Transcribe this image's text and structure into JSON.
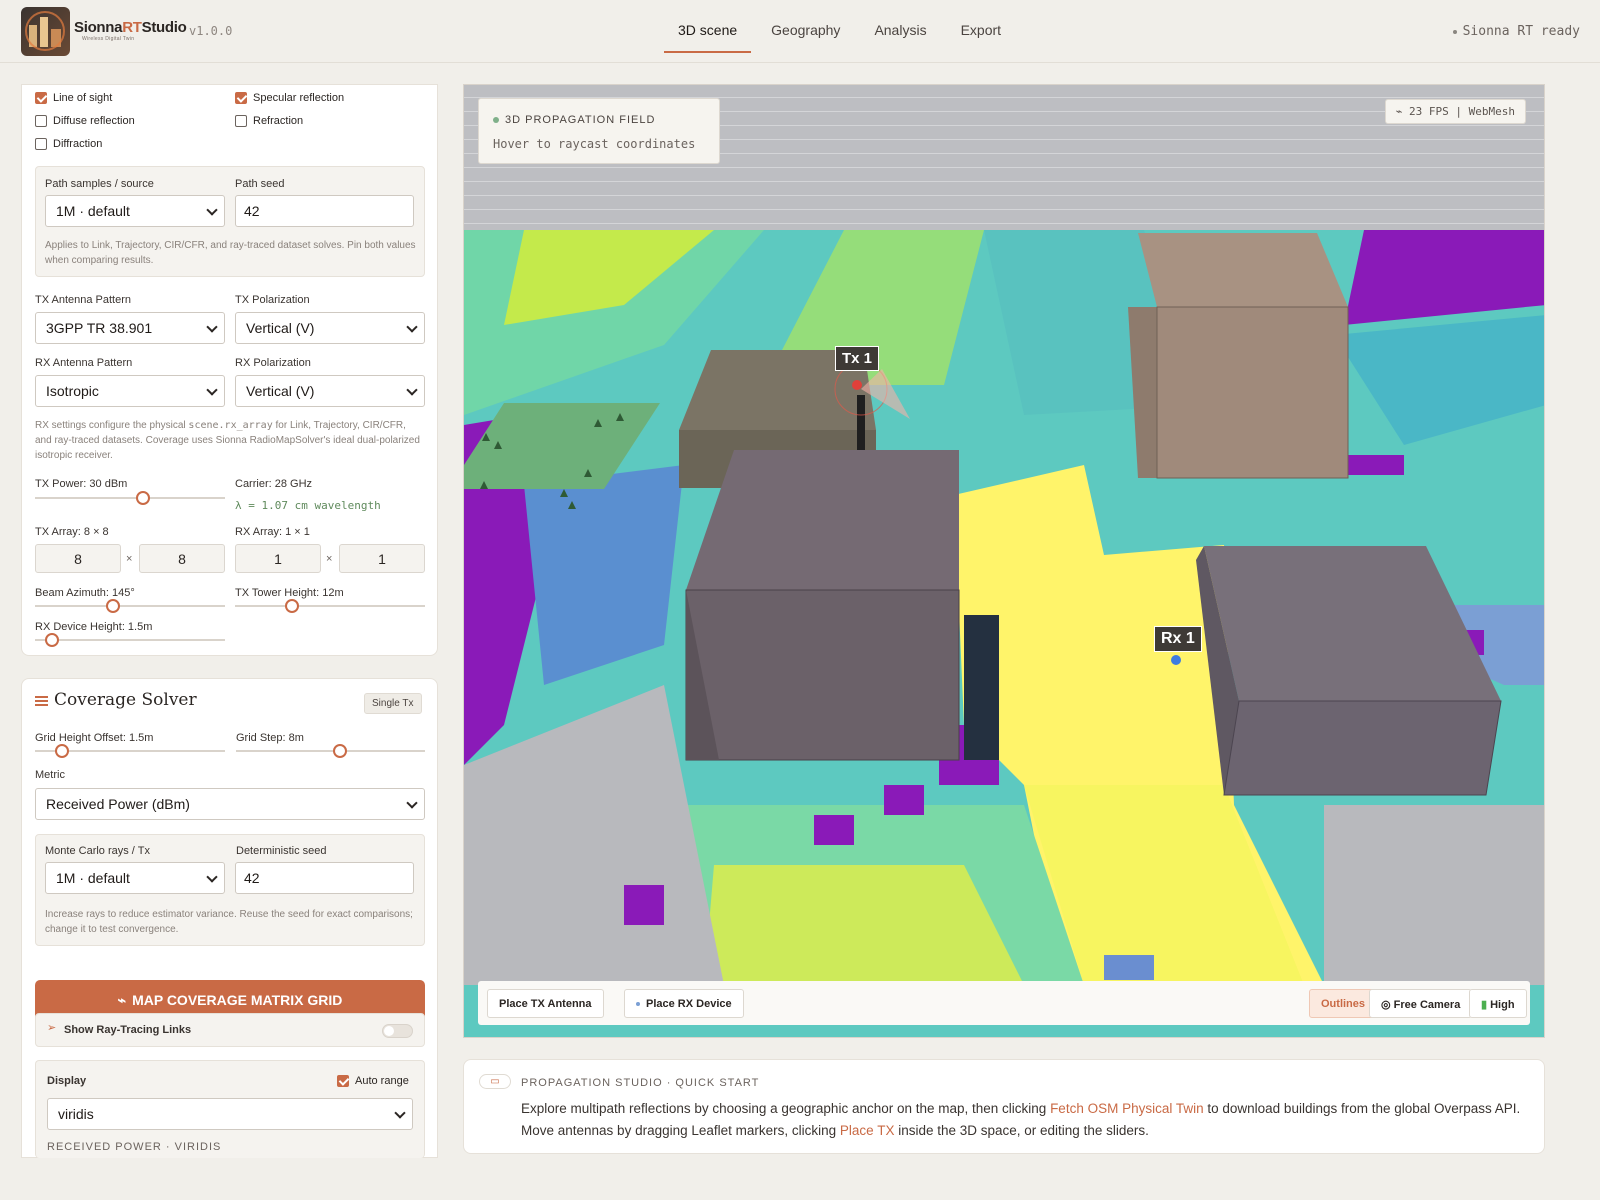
{
  "app": {
    "brand_prefix": "Sionna",
    "brand_rt": "RT",
    "brand_suffix": "Studio",
    "brand_sub": "Wireless Digital Twin",
    "version": "v1.0.0",
    "status": "Sionna RT ready"
  },
  "nav": {
    "tabs": [
      {
        "label": "3D scene",
        "active": true
      },
      {
        "label": "Geography"
      },
      {
        "label": "Analysis"
      },
      {
        "label": "Export"
      }
    ]
  },
  "interactions": {
    "line_of_sight": "Line of sight",
    "specular": "Specular reflection",
    "diffuse": "Diffuse reflection",
    "refraction": "Refraction",
    "diffraction": "Diffraction",
    "checked": {
      "line_of_sight": true,
      "specular": true,
      "diffuse": false,
      "refraction": false,
      "diffraction": false
    }
  },
  "paths": {
    "samples_label": "Path samples / source",
    "samples_value": "1M · default",
    "seed_label": "Path seed",
    "seed_value": "42",
    "help": "Applies to Link, Trajectory, CIR/CFR, and ray-traced dataset solves. Pin both values when comparing results."
  },
  "antenna": {
    "tx_pattern_label": "TX Antenna Pattern",
    "tx_pattern": "3GPP TR 38.901",
    "tx_pol_label": "TX Polarization",
    "tx_pol": "Vertical (V)",
    "rx_pattern_label": "RX Antenna Pattern",
    "rx_pattern": "Isotropic",
    "rx_pol_label": "RX Polarization",
    "rx_pol": "Vertical (V)",
    "help_a": "RX settings configure the physical ",
    "help_code": "scene.rx_array",
    "help_b": " for Link, Trajectory, CIR/CFR, and ray-traced datasets. Coverage uses Sionna RadioMapSolver's ideal dual-polarized isotropic receiver.",
    "tx_power": "TX Power: 30 dBm",
    "tx_power_level": 0.57,
    "carrier": "Carrier: 28 GHz",
    "wavelength": "λ = 1.07 cm wavelength",
    "tx_array": "TX Array: 8 × 8",
    "tx_rows": "8",
    "tx_cols": "8",
    "rx_array": "RX Array: 1 × 1",
    "rx_rows": "1",
    "rx_cols": "1",
    "times": "×",
    "beam_az": "Beam Azimuth: 145°",
    "beam_az_level": 0.41,
    "tower_h": "TX Tower Height: 12m",
    "tower_h_level": 0.3,
    "rx_h": "RX Device Height: 1.5m",
    "rx_h_level": 0.09
  },
  "coverage": {
    "title": "Coverage Solver",
    "badge": "Single Tx",
    "grid_offset": "Grid Height Offset: 1.5m",
    "grid_offset_level": 0.14,
    "grid_step": "Grid Step: 8m",
    "grid_step_level": 0.55,
    "metric_label": "Metric",
    "metric": "Received Power (dBm)",
    "rays_label": "Monte Carlo rays / Tx",
    "rays": "1M · default",
    "seed_label": "Deterministic seed",
    "seed": "42",
    "help": "Increase rays to reduce estimator variance. Reuse the seed for exact comparisons; change it to test convergence.",
    "button": "MAP COVERAGE MATRIX GRID",
    "show_links": "Show Ray-Tracing Links",
    "display_label": "Display",
    "auto_range": "Auto range",
    "colormap": "viridis",
    "legend_title": "RECEIVED POWER · VIRIDIS"
  },
  "viewport": {
    "field_title": "3D PROPAGATION FIELD",
    "field_hint": "Hover to raycast coordinates",
    "fps": "23 FPS | WebMesh",
    "tx_label": "Tx 1",
    "rx_label": "Rx 1",
    "place_tx": "Place TX Antenna",
    "place_rx": "Place RX Device",
    "outlines": "Outlines",
    "free_camera": "Free Camera",
    "quality": "High"
  },
  "quickstart": {
    "title": "PROPAGATION STUDIO · QUICK START",
    "t1": "Explore multipath reflections by choosing a geographic anchor on the map, then clicking ",
    "l1": "Fetch OSM Physical Twin",
    "t2": " to download buildings from the global Overpass API. Move antennas by dragging Leaflet markers, clicking ",
    "l2": "Place TX",
    "t3": " inside the 3D space, or editing the sliders."
  },
  "colors": {
    "accent": "#c96a45",
    "viridis_low": "#440154",
    "viridis_mid": "#21918c",
    "viridis_high": "#fde725"
  }
}
